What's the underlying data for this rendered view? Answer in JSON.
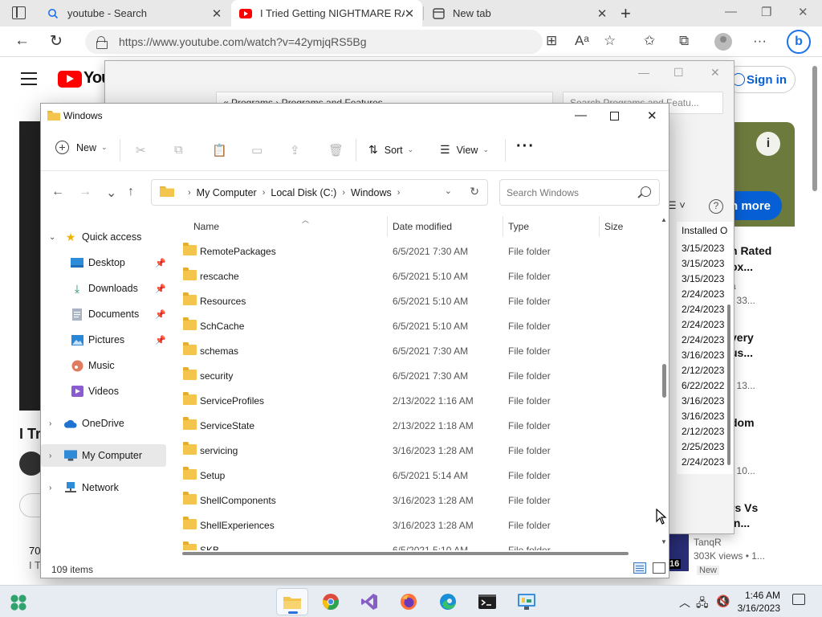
{
  "browser": {
    "tabs": [
      {
        "label": "youtube - Search",
        "icon": "search-icon"
      },
      {
        "label": "I Tried Getting NIGHTMARE RAN",
        "icon": "youtube-icon"
      },
      {
        "label": "New tab",
        "icon": "newtab-icon"
      }
    ],
    "url": "https://www.youtube.com/watch?v=42ymjqRS5Bg"
  },
  "youtube": {
    "logo_text": "You",
    "sign_in": "Sign in",
    "info": "i",
    "learn_more": "n more",
    "title_fragment": "I Tr",
    "desc1": "70",
    "desc2": "I T",
    "side": [
      {
        "title": "n Rated",
        "sub": "ox..."
      },
      {
        "title": "a",
        "sub": "• 33..."
      },
      {
        "title": "very",
        "sub": "us..."
      },
      {
        "title": "s",
        "sub": "• 13..."
      },
      {
        "title": "dom",
        "sub": ""
      },
      {
        "title": "s",
        "sub": "• 10..."
      },
      {
        "title": "rs Vs",
        "sub": "in..."
      }
    ],
    "channel": "TanqR",
    "views": "303K views • 1...",
    "duration": "16",
    "new_badge": "New"
  },
  "programs": {
    "address": "« Programs › Programs and Features",
    "search_placeholder": "Search Programs and Featu...",
    "col_installed": "Installed O",
    "dates": [
      "3/15/2023",
      "3/15/2023",
      "3/15/2023",
      "2/24/2023",
      "2/24/2023",
      "2/24/2023",
      "2/24/2023",
      "3/16/2023",
      "2/12/2023",
      "6/22/2022",
      "3/16/2023",
      "3/16/2023",
      "2/12/2023",
      "2/25/2023",
      "2/24/2023"
    ]
  },
  "explorer": {
    "title": "Windows",
    "toolbar": {
      "new": "New",
      "sort": "Sort",
      "view": "View",
      "more": "···"
    },
    "breadcrumb": [
      "My Computer",
      "Local Disk (C:)",
      "Windows"
    ],
    "search_placeholder": "Search Windows",
    "sidebar": [
      {
        "label": "Quick access",
        "icon": "star-icon"
      },
      {
        "label": "Desktop",
        "icon": "desktop-icon"
      },
      {
        "label": "Downloads",
        "icon": "download-icon"
      },
      {
        "label": "Documents",
        "icon": "document-icon"
      },
      {
        "label": "Pictures",
        "icon": "pictures-icon"
      },
      {
        "label": "Music",
        "icon": "music-icon"
      },
      {
        "label": "Videos",
        "icon": "videos-icon"
      },
      {
        "label": "OneDrive",
        "icon": "cloud-icon"
      },
      {
        "label": "My Computer",
        "icon": "computer-icon"
      },
      {
        "label": "Network",
        "icon": "network-icon"
      }
    ],
    "columns": {
      "name": "Name",
      "date": "Date modified",
      "type": "Type",
      "size": "Size"
    },
    "files": [
      {
        "name": "RemotePackages",
        "date": "6/5/2021 7:30 AM",
        "type": "File folder"
      },
      {
        "name": "rescache",
        "date": "6/5/2021 5:10 AM",
        "type": "File folder"
      },
      {
        "name": "Resources",
        "date": "6/5/2021 5:10 AM",
        "type": "File folder"
      },
      {
        "name": "SchCache",
        "date": "6/5/2021 5:10 AM",
        "type": "File folder"
      },
      {
        "name": "schemas",
        "date": "6/5/2021 7:30 AM",
        "type": "File folder"
      },
      {
        "name": "security",
        "date": "6/5/2021 7:30 AM",
        "type": "File folder"
      },
      {
        "name": "ServiceProfiles",
        "date": "2/13/2022 1:16 AM",
        "type": "File folder"
      },
      {
        "name": "ServiceState",
        "date": "2/13/2022 1:18 AM",
        "type": "File folder"
      },
      {
        "name": "servicing",
        "date": "3/16/2023 1:28 AM",
        "type": "File folder"
      },
      {
        "name": "Setup",
        "date": "6/5/2021 5:14 AM",
        "type": "File folder"
      },
      {
        "name": "ShellComponents",
        "date": "3/16/2023 1:28 AM",
        "type": "File folder"
      },
      {
        "name": "ShellExperiences",
        "date": "3/16/2023 1:28 AM",
        "type": "File folder"
      },
      {
        "name": "SKB",
        "date": "6/5/2021 5:10 AM",
        "type": "File folder"
      }
    ],
    "status": "109 items"
  },
  "taskbar": {
    "time": "1:46 AM",
    "date": "3/16/2023"
  },
  "colors": {
    "accent": "#0067c0",
    "folder": "#f3c54d",
    "youtube_red": "#ff0000"
  }
}
